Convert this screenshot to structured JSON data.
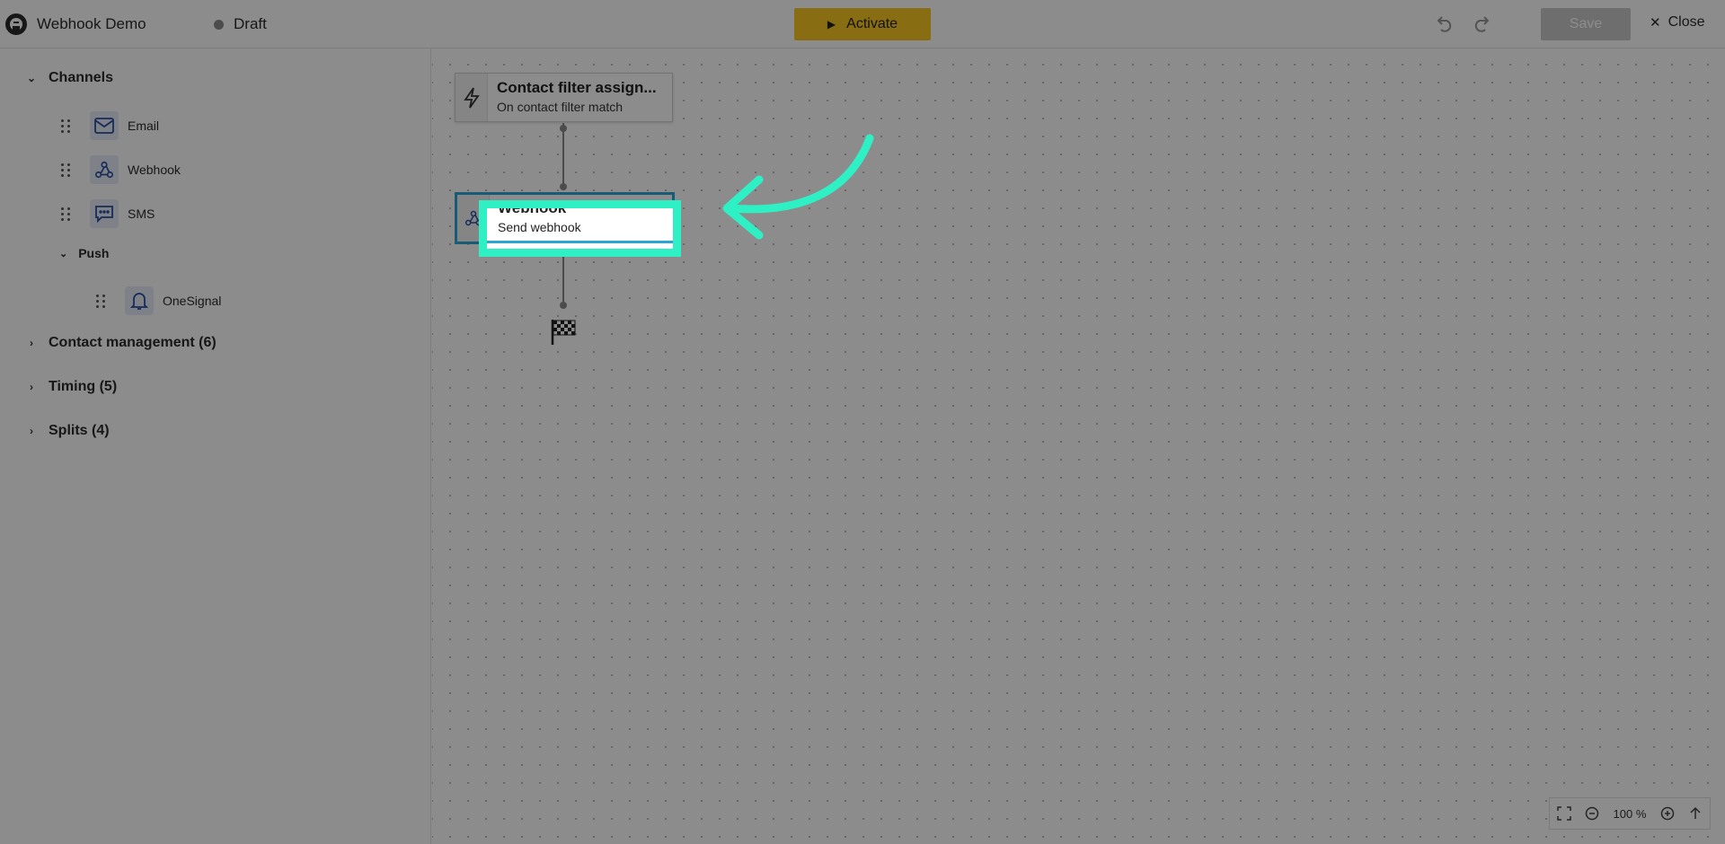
{
  "header": {
    "title": "Webhook Demo",
    "status": "Draft",
    "activate_label": "Activate",
    "save_label": "Save",
    "close_label": "Close"
  },
  "sidebar": {
    "channels": {
      "label": "Channels",
      "items": [
        {
          "label": "Email",
          "icon": "mail-icon"
        },
        {
          "label": "Webhook",
          "icon": "webhook-icon"
        },
        {
          "label": "SMS",
          "icon": "sms-icon"
        }
      ],
      "push": {
        "label": "Push",
        "items": [
          {
            "label": "OneSignal",
            "icon": "bell-icon"
          }
        ]
      }
    },
    "categories": [
      {
        "label": "Contact management (6)"
      },
      {
        "label": "Timing (5)"
      },
      {
        "label": "Splits (4)"
      }
    ]
  },
  "canvas": {
    "trigger_node": {
      "title": "Contact filter assign...",
      "subtitle": "On contact filter match"
    },
    "webhook_node": {
      "title": "Webhook",
      "subtitle": "Send webhook"
    }
  },
  "zoom": {
    "level": "100 %"
  },
  "colors": {
    "activate": "#f7c624",
    "highlight": "#2ef0c4",
    "selected_border": "#2ba6d4",
    "icon_blue": "#2a4f9e"
  }
}
